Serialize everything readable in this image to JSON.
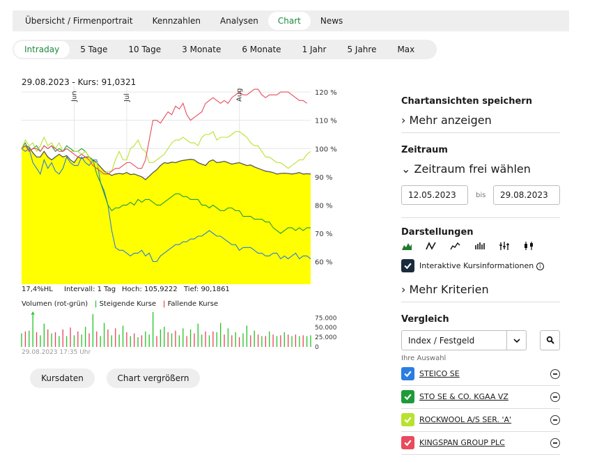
{
  "topnav": {
    "tabs": [
      {
        "label": "Übersicht / Firmenportrait",
        "active": false
      },
      {
        "label": "Kennzahlen",
        "active": false
      },
      {
        "label": "Analysen",
        "active": false
      },
      {
        "label": "Chart",
        "active": true
      },
      {
        "label": "News",
        "active": false
      }
    ]
  },
  "rangenav": {
    "tabs": [
      {
        "label": "Intraday",
        "active": true
      },
      {
        "label": "5 Tage",
        "active": false
      },
      {
        "label": "10 Tage",
        "active": false
      },
      {
        "label": "3 Monate",
        "active": false
      },
      {
        "label": "6 Monate",
        "active": false
      },
      {
        "label": "1 Jahr",
        "active": false
      },
      {
        "label": "5 Jahre",
        "active": false
      },
      {
        "label": "Max",
        "active": false
      }
    ]
  },
  "chart_info": "29.08.2023  -  Kurs: 91,0321",
  "stats": {
    "hl": "17,4%HL",
    "interval": "Intervall: 1 Tag",
    "high": "Hoch: 105,9222",
    "low": "Tief: 90,1861"
  },
  "volume": {
    "title": "Volumen (rot-grün)",
    "rising_label": "Steigende Kurse",
    "falling_label": "Fallende Kurse",
    "timestamp": "29.08.2023 17:35 Uhr"
  },
  "buttons": {
    "kursdaten": "Kursdaten",
    "enlarge": "Chart vergrößern"
  },
  "sidebar": {
    "save_title": "Chartansichten speichern",
    "more_link": "Mehr anzeigen",
    "zeitraum_title": "Zeitraum",
    "zeitraum_link": "Zeitraum frei wählen",
    "date_from": "12.05.2023",
    "bis": "bis",
    "date_to": "29.08.2023",
    "darstellungen_title": "Darstellungen",
    "interactive_label": "Interaktive Kursinformationen",
    "more_criteria": "Mehr Kriterien",
    "vergleich_title": "Vergleich",
    "select_value": "Index / Festgeld",
    "your_selection": "Ihre Auswahl",
    "comparisons": [
      {
        "name": "STEICO SE",
        "color": "#2a7de1"
      },
      {
        "name": "STO SE & CO. KGAA VZ",
        "color": "#1f9a3a"
      },
      {
        "name": "ROCKWOOL A/S SER. 'A'",
        "color": "#b7e22f"
      },
      {
        "name": "KINGSPAN GROUP PLC",
        "color": "#e84b5c"
      }
    ]
  },
  "chart_data": {
    "type": "line",
    "main_area_color": "#ffff00",
    "x_tick_labels": [
      "Jun",
      "Jul",
      "Aug"
    ],
    "x_tick_positions": [
      14,
      28,
      58
    ],
    "y_tick_labels": [
      "120 %",
      "110 %",
      "100 %",
      "90 %",
      "80 %",
      "70 %",
      "60 %"
    ],
    "y_ticks": [
      120,
      110,
      100,
      90,
      80,
      70,
      60
    ],
    "ylim": [
      52,
      122
    ],
    "n_points": 78,
    "series": [
      {
        "key": "main",
        "color": "#555555",
        "values": [
          100,
          101,
          100.5,
          98.5,
          97,
          97,
          99,
          97,
          96,
          97,
          98,
          97,
          97.5,
          96,
          95,
          97,
          96.5,
          97,
          97,
          96,
          95,
          93.5,
          92,
          91.2,
          90.5,
          91,
          91.2,
          91,
          91.5,
          90.8,
          91,
          90.5,
          90,
          89,
          90.2,
          91.5,
          92.5,
          94,
          95,
          94.8,
          95.2,
          95,
          95.5,
          95.8,
          96,
          96.2,
          96,
          95,
          94.5,
          94,
          95.5,
          96,
          95,
          95.2,
          95.5,
          95,
          94.5,
          94.8,
          95,
          94.5,
          94,
          94.2,
          93.5,
          93,
          92.5,
          92,
          91.8,
          91.5,
          91,
          91.2,
          91.3,
          91.2,
          91,
          91.2,
          91.5,
          91,
          91.1,
          91
        ]
      },
      {
        "key": "steico",
        "color": "#2a7de1",
        "values": [
          100,
          99,
          100,
          95,
          93,
          91,
          96,
          93,
          95,
          92,
          91,
          93,
          97,
          95,
          94,
          94,
          97,
          95,
          94,
          96,
          96,
          88,
          85,
          80,
          71,
          65,
          64,
          64,
          63,
          62,
          63,
          63,
          64,
          62,
          63,
          60,
          60,
          62,
          63,
          64,
          65,
          66,
          66,
          67,
          67,
          68,
          68,
          69,
          69,
          70,
          71,
          70,
          69,
          69,
          68,
          67,
          66,
          66,
          64,
          65,
          65,
          65,
          64,
          63,
          63,
          62,
          62,
          63,
          63,
          61,
          62,
          61,
          62,
          63,
          61,
          62,
          62,
          61
        ]
      },
      {
        "key": "sto",
        "color": "#1f9a3a",
        "values": [
          100,
          102,
          99,
          100,
          101,
          99,
          101,
          100,
          101,
          99,
          100,
          99,
          101,
          100,
          99,
          99,
          100,
          99,
          97,
          96,
          91,
          88,
          84,
          80,
          78,
          79,
          79,
          80,
          80,
          81,
          80,
          82,
          81,
          82,
          82,
          81,
          80,
          80,
          81,
          82,
          83,
          84,
          84,
          83,
          83,
          82,
          82,
          82,
          80,
          80,
          79,
          80,
          79,
          78,
          78,
          79,
          79,
          78,
          78,
          76,
          76,
          76,
          75,
          75,
          75,
          74,
          74,
          72,
          71,
          70,
          71,
          72,
          72,
          71,
          72,
          71,
          72,
          72
        ]
      },
      {
        "key": "rockwool",
        "color": "#b7e22f",
        "values": [
          100,
          103,
          101,
          102,
          99,
          101,
          104,
          101,
          102,
          100,
          102,
          99,
          100,
          99,
          99,
          99,
          98,
          99,
          97,
          95,
          95,
          91,
          91,
          92,
          92,
          96,
          99,
          96,
          96,
          100,
          101,
          103,
          100,
          99,
          95,
          95,
          96,
          97,
          98,
          100,
          102,
          103,
          103,
          104,
          103,
          102,
          102,
          101,
          104,
          105,
          105,
          106,
          103,
          104,
          104,
          104,
          105,
          106,
          106,
          105,
          104,
          102,
          101,
          101,
          99,
          97,
          97,
          96,
          95,
          95,
          94,
          93,
          94,
          95,
          96,
          96,
          98,
          99
        ]
      },
      {
        "key": "kingspan",
        "color": "#e84b5c",
        "values": [
          100,
          101,
          99,
          100,
          100,
          99,
          101,
          100,
          101,
          100,
          99,
          99,
          100,
          99,
          98,
          97,
          98,
          97,
          96,
          94,
          93,
          92,
          91,
          91,
          92,
          93,
          93,
          94,
          95,
          95,
          94,
          93,
          93,
          96,
          103,
          110,
          110,
          109,
          111,
          113,
          112,
          115,
          114,
          116,
          112,
          110,
          111,
          112,
          113,
          116,
          117,
          118,
          117,
          116,
          117,
          116,
          118,
          119,
          120,
          119,
          119,
          120,
          121,
          121,
          119,
          118,
          119,
          119,
          119,
          120,
          120,
          120,
          119,
          118,
          117,
          117,
          116
        ]
      }
    ],
    "volume": {
      "y_tick_labels": [
        "75.000",
        "50.000",
        "25.000",
        "0"
      ],
      "y_ticks": [
        75000,
        50000,
        25000,
        0
      ],
      "ymax": 90000,
      "values": [
        35000,
        40000,
        42000,
        100000,
        38000,
        30000,
        60000,
        45000,
        35000,
        38000,
        28000,
        45000,
        28000,
        50000,
        30000,
        40000,
        32000,
        52000,
        35000,
        85000,
        40000,
        28000,
        62000,
        45000,
        30000,
        48000,
        32000,
        55000,
        38000,
        28000,
        35000,
        25000,
        30000,
        40000,
        32000,
        90000,
        28000,
        45000,
        52000,
        38000,
        35000,
        42000,
        30000,
        48000,
        28000,
        45000,
        35000,
        60000,
        32000,
        40000,
        30000,
        40000,
        38000,
        62000,
        32000,
        48000,
        30000,
        38000,
        25000,
        35000,
        55000,
        30000,
        42000,
        32000,
        28000,
        28000,
        40000,
        32000,
        28000,
        30000,
        38000,
        32000,
        28000,
        32000,
        28000,
        30000,
        28000,
        30000
      ],
      "rising": [
        true,
        false,
        true,
        true,
        false,
        true,
        true,
        false,
        true,
        false,
        true,
        false,
        true,
        false,
        true,
        false,
        true,
        true,
        false,
        true,
        false,
        true,
        true,
        false,
        true,
        false,
        true,
        true,
        false,
        true,
        false,
        true,
        false,
        true,
        true,
        true,
        false,
        true,
        true,
        false,
        true,
        false,
        true,
        true,
        false,
        true,
        false,
        true,
        true,
        false,
        true,
        false,
        true,
        true,
        false,
        true,
        false,
        true,
        false,
        true,
        true,
        false,
        true,
        false,
        true,
        false,
        true,
        false,
        true,
        false,
        true,
        false,
        true,
        false,
        true,
        false,
        true,
        true
      ]
    }
  }
}
